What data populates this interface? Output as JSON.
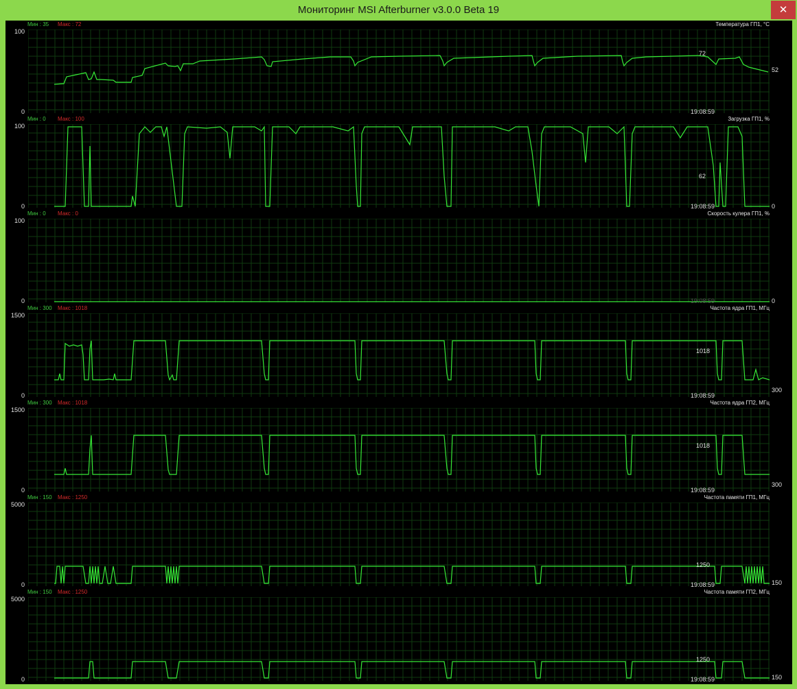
{
  "window": {
    "title": "Мониторинг MSI Afterburner v3.0.0 Beta 19",
    "close_glyph": "✕",
    "accent": "#8cd84c"
  },
  "colors": {
    "trace": "#36ea36",
    "grid": "#0f3a0f",
    "min": "#3fc83f",
    "max": "#d42a2a"
  },
  "graphs": [
    {
      "title": "Температура ГП1, °С",
      "min_label": "Мин : 35",
      "max_label": "Макс : 72",
      "axis_top": "100",
      "axis_bottom": "0",
      "marker": "72",
      "current": "52",
      "time": "19:08:59",
      "range": [
        0,
        100
      ]
    },
    {
      "title": "Загрузка ГП1, %",
      "min_label": "Мин : 0",
      "max_label": "Макс : 100",
      "axis_top": "100",
      "axis_bottom": "0",
      "marker": "62",
      "current": "0",
      "time": "19:08:59",
      "range": [
        0,
        100
      ]
    },
    {
      "title": "Скорость кулера ГП1, %",
      "min_label": "Мин : 0",
      "max_label": "Макс : 0",
      "axis_top": "100",
      "axis_bottom": "0",
      "marker": "",
      "current": "0",
      "time": "19:08:59",
      "range": [
        0,
        100
      ]
    },
    {
      "title": "Частота ядра ГП1, МГц",
      "min_label": "Мин : 300",
      "max_label": "Макс : 1018",
      "axis_top": "1500",
      "axis_bottom": "0",
      "marker": "1018",
      "current": "300",
      "time": "19:08:59",
      "range": [
        0,
        1500
      ]
    },
    {
      "title": "Частота ядра ГП2, МГц",
      "min_label": "Мин : 300",
      "max_label": "Макс : 1018",
      "axis_top": "1500",
      "axis_bottom": "0",
      "marker": "1018",
      "current": "300",
      "time": "19:08:59",
      "range": [
        0,
        1500
      ]
    },
    {
      "title": "Частота памяти ГП1, МГц",
      "min_label": "Мин : 150",
      "max_label": "Макс : 1250",
      "axis_top": "5000",
      "axis_bottom": "0",
      "marker": "1250",
      "current": "150",
      "time": "19:08:59",
      "range": [
        0,
        5000
      ]
    },
    {
      "title": "Частота памяти ГП2, МГц",
      "min_label": "Мин : 150",
      "max_label": "Макс : 1250",
      "axis_top": "5000",
      "axis_bottom": "0",
      "marker": "1250",
      "current": "150",
      "time": "19:08:59",
      "range": [
        0,
        5000
      ]
    }
  ]
}
